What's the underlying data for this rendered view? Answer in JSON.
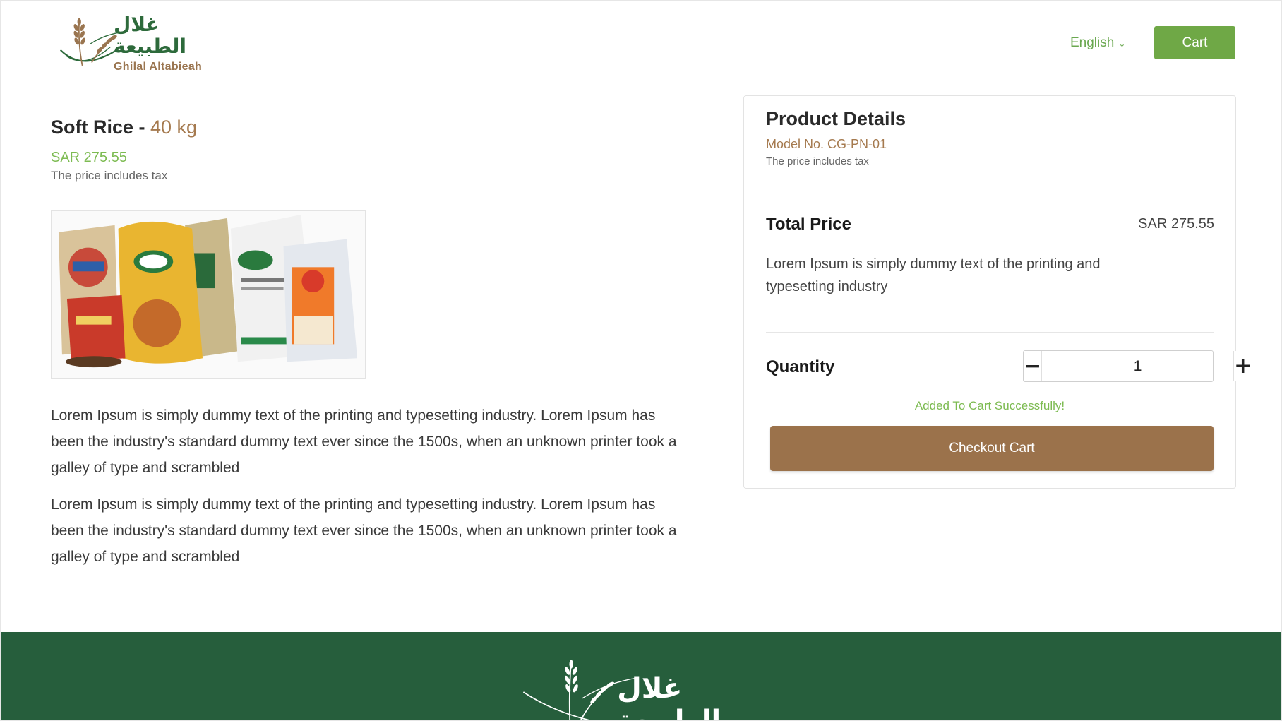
{
  "header": {
    "logo_arabic": "غلال الطبيعة",
    "logo_english": "Ghilal Altabieah",
    "language_label": "English",
    "cart_label": "Cart"
  },
  "product": {
    "name": "Soft Rice - ",
    "weight": "40 kg",
    "price": "SAR 275.55",
    "tax_note": "The price includes tax",
    "description_1": "Lorem Ipsum is simply dummy text of the printing and typesetting industry. Lorem Ipsum has been the industry's standard dummy text ever since the 1500s, when an unknown printer took a galley of type and scrambled",
    "description_2": "Lorem Ipsum is simply dummy text of the printing and typesetting industry. Lorem Ipsum has been the industry's standard dummy text ever since the 1500s, when an unknown printer took a galley of type and scrambled"
  },
  "details_panel": {
    "title": "Product Details",
    "model_no": "Model No.  CG-PN-01",
    "tax_note": "The price includes tax",
    "total_label": "Total Price",
    "total_value": "SAR 275.55",
    "description": "Lorem Ipsum is simply dummy text of the printing and typesetting industry",
    "quantity_label": "Quantity",
    "quantity_value": "1",
    "minus_symbol": "−",
    "plus_symbol": "+",
    "success_message": "Added To Cart Successfully!",
    "checkout_label": "Checkout Cart"
  },
  "footer": {
    "logo_arabic": "غلال الطبيعة"
  },
  "colors": {
    "brand_green": "#6fa846",
    "brand_brown": "#9b724b",
    "footer_green": "#265e3c",
    "price_green": "#7dbb52"
  },
  "icons": {
    "language_dropdown": "chevron-down-icon",
    "qty_minus": "minus-icon",
    "qty_plus": "plus-icon",
    "logo_mark": "wheat-icon"
  }
}
